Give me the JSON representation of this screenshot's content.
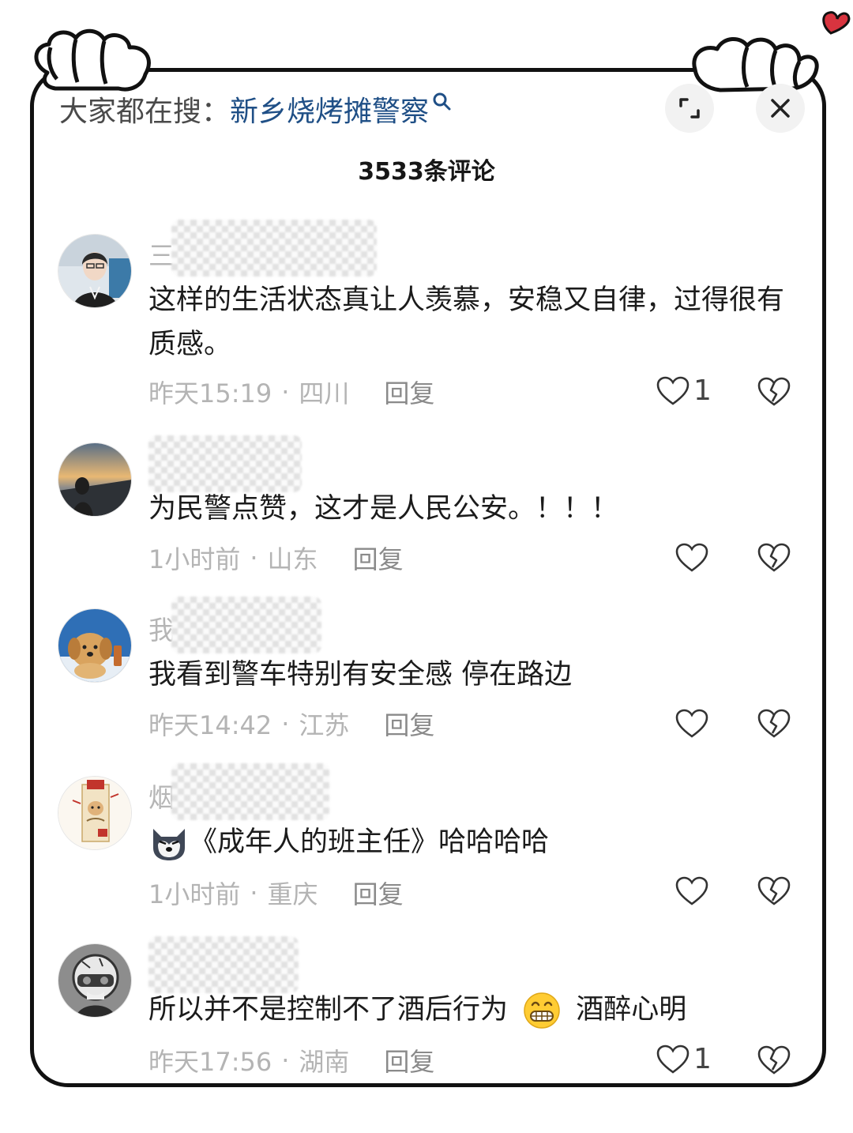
{
  "search_bar": {
    "prefix": "大家都在搜：",
    "keyword": "新乡烧烤摊警察"
  },
  "header": {
    "comment_count": "3533条评论"
  },
  "icons": {
    "search": "search-icon",
    "expand": "expand-icon",
    "close": "close-icon",
    "like": "heart-icon",
    "dislike": "broken-heart-icon",
    "frame_decoration": "cartoon-hands-holding-frame",
    "heart_decoration": "red-heart-icon"
  },
  "colors": {
    "keyword": "#1f4f86",
    "heart_decoration": "#d8343f"
  },
  "comments": [
    {
      "username_visible": "三",
      "text": "这样的生活状态真让人羡慕，安稳又自律，过得很有质感。",
      "time": "昨天15:19",
      "location": "四川",
      "reply_label": "回复",
      "likes": "1"
    },
    {
      "username_visible": "",
      "text": "为民警点赞，这才是人民公安。！！！",
      "time": "1小时前",
      "location": "山东",
      "reply_label": "回复",
      "likes": ""
    },
    {
      "username_visible": "我",
      "text": "我看到警车特别有安全感 停在路边",
      "time": "昨天14:42",
      "location": "江苏",
      "reply_label": "回复",
      "likes": ""
    },
    {
      "username_visible": "烟",
      "text": "《成年人的班主任》哈哈哈哈",
      "emoji": "husky-dog-emoji",
      "time": "1小时前",
      "location": "重庆",
      "reply_label": "回复",
      "likes": ""
    },
    {
      "username_visible": "",
      "text_before_emoji": "所以并不是控制不了酒后行为",
      "emoji": "grinning-face-emoji",
      "text_after_emoji": "酒醉心明",
      "time": "昨天17:56",
      "location": "湖南",
      "reply_label": "回复",
      "likes": "1"
    }
  ]
}
